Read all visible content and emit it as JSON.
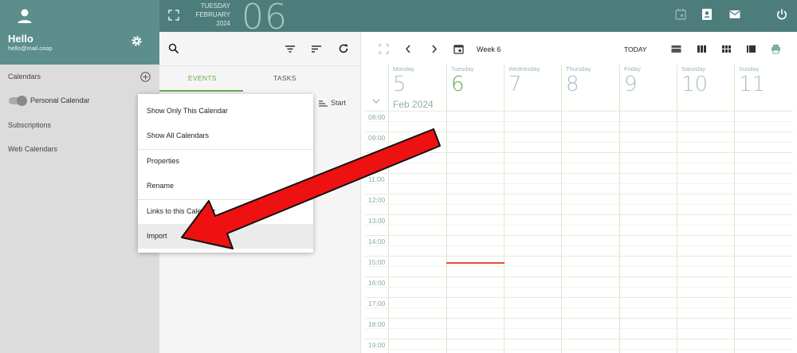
{
  "header": {
    "weekday": "TUESDAY",
    "month": "FEBRUARY",
    "year": "2024",
    "day": "06"
  },
  "user": {
    "greeting": "Hello",
    "email": "hello@mail.coop"
  },
  "sidebar": {
    "calendars_label": "Calendars",
    "personal_calendar": "Personal Calendar",
    "subscriptions_label": "Subscriptions",
    "web_calendars_label": "Web Calendars"
  },
  "list_panel": {
    "tabs": [
      {
        "label": "EVENTS"
      },
      {
        "label": "TASKS"
      }
    ],
    "sort_label": "Start"
  },
  "context_menu": {
    "items": [
      {
        "label": "Show Only This Calendar"
      },
      {
        "label": "Show All Calendars"
      },
      {
        "label": "Properties"
      },
      {
        "label": "Rename"
      },
      {
        "label": "Links to this Calendar"
      },
      {
        "label": "Import"
      }
    ]
  },
  "calendar": {
    "week_label": "Week 6",
    "today_label": "TODAY",
    "month_label": "Feb 2024",
    "days": [
      {
        "name": "Monday",
        "num": "5"
      },
      {
        "name": "Tuesday",
        "num": "6"
      },
      {
        "name": "Wednesday",
        "num": "7"
      },
      {
        "name": "Thursday",
        "num": "8"
      },
      {
        "name": "Friday",
        "num": "9"
      },
      {
        "name": "Saturday",
        "num": "10"
      },
      {
        "name": "Sunday",
        "num": "11"
      }
    ],
    "hours": [
      "08:00",
      "09:00",
      "10:00",
      "11:00",
      "12:00",
      "13:00",
      "14:00",
      "15:00",
      "16:00",
      "17:00",
      "18:00",
      "19:00"
    ]
  },
  "colors": {
    "header_bg": "#4d7d7a",
    "accent_green": "#6aa84f",
    "now_line": "#e74c3c",
    "annotation_arrow": "#ee1111"
  }
}
